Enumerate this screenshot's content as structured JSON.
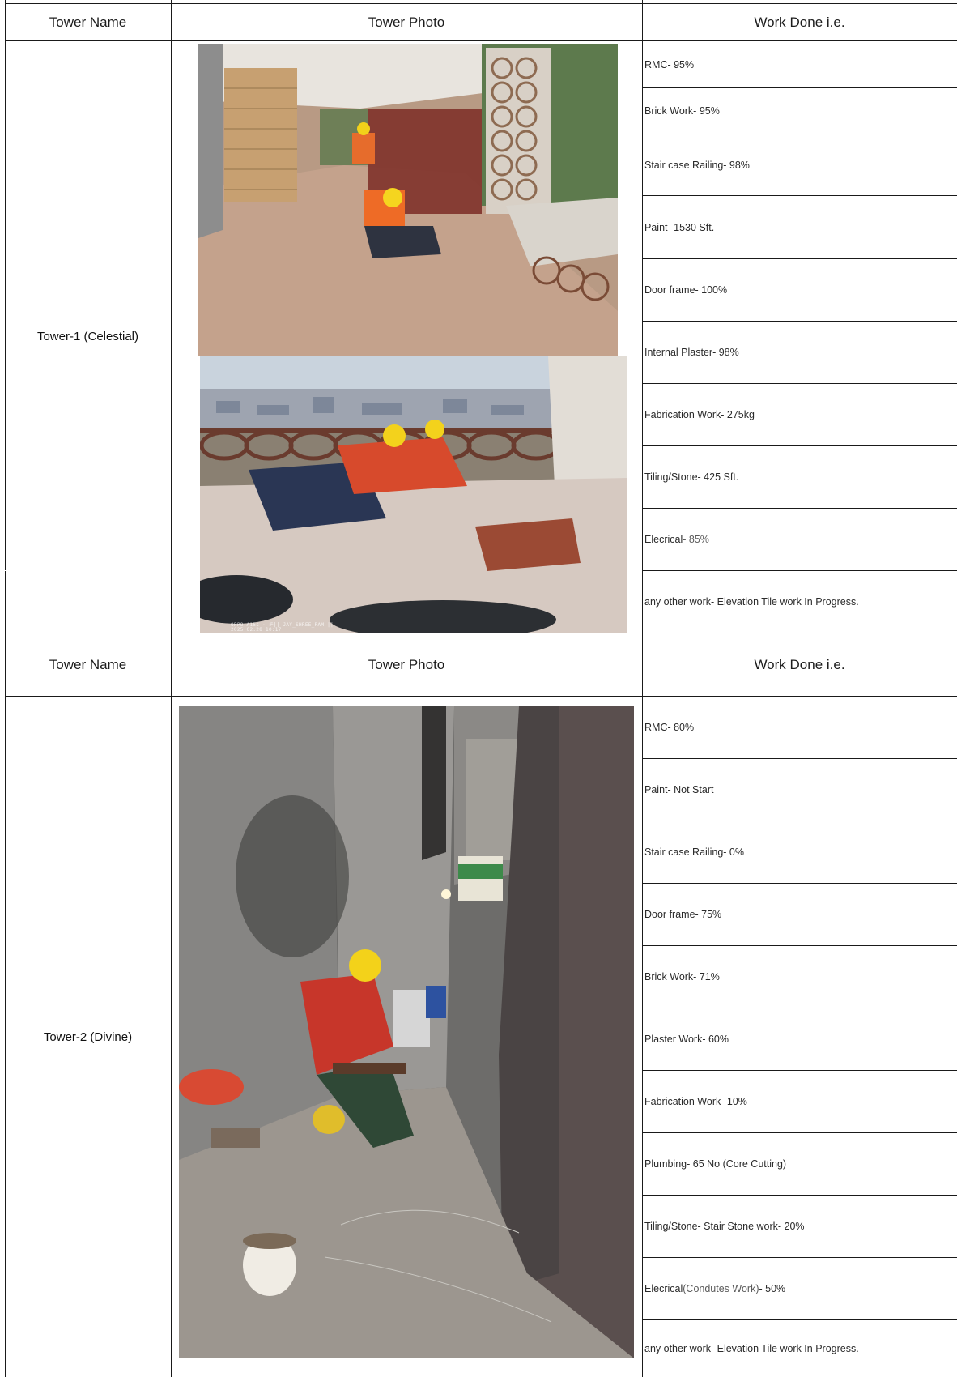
{
  "headers": {
    "tower_name": "Tower Name",
    "tower_photo": "Tower Photo",
    "work_done": "Work Done i.e."
  },
  "towers": [
    {
      "name": "Tower-1 (Celestial)",
      "photos": [
        {
          "name": "tower1-balcony-photo"
        },
        {
          "name": "tower1-railing-photo",
          "stamp_line1": "OPPO A15s · ॐ|| JAY_SHREE_RAM ||",
          "stamp_line2": "2025.02.28 10:17"
        }
      ],
      "work_items": [
        {
          "pre": "RMC- 95%",
          "mid": "",
          "post": ""
        },
        {
          "pre": "Brick Work- 95%",
          "mid": "",
          "post": ""
        },
        {
          "pre": "Stair case Railing- 98%",
          "mid": "",
          "post": ""
        },
        {
          "pre": "Paint- 1530 Sft.",
          "mid": "",
          "post": ""
        },
        {
          "pre": "Door frame- 100%",
          "mid": "",
          "post": ""
        },
        {
          "pre": "Internal Plaster- 98%",
          "mid": "",
          "post": ""
        },
        {
          "pre": "Fabrication Work- 275kg",
          "mid": "",
          "post": ""
        },
        {
          "pre": "Tiling/Stone- 425 Sft.",
          "mid": "",
          "post": ""
        },
        {
          "pre": "Elecrical",
          "mid": "- 85%",
          "post": ""
        },
        {
          "pre": "any other work",
          "mid": "",
          "post": "- Elevation Tile work In Progress."
        }
      ]
    },
    {
      "name": "Tower-2 (Divine)",
      "photos": [
        {
          "name": "tower2-core-cutting-photo"
        }
      ],
      "work_items": [
        {
          "pre": "RMC- 80%",
          "mid": "",
          "post": ""
        },
        {
          "pre": "Paint- Not Start",
          "mid": "",
          "post": ""
        },
        {
          "pre": "Stair case Railing- 0%",
          "mid": "",
          "post": ""
        },
        {
          "pre": "Door frame- 75%",
          "mid": "",
          "post": ""
        },
        {
          "pre": "Brick Work- 71%",
          "mid": "",
          "post": ""
        },
        {
          "pre": "Plaster Work-  60%",
          "mid": "",
          "post": ""
        },
        {
          "pre": "Fabrication Work- 10%",
          "mid": "",
          "post": ""
        },
        {
          "pre": "Plumbing- 65 No (Core Cutting)",
          "mid": "",
          "post": ""
        },
        {
          "pre": "Tiling/Stone- Stair Stone work- 20%",
          "mid": "",
          "post": ""
        },
        {
          "pre": "Elecrical",
          "mid": " (Condutes Work)",
          "post": "- 50%"
        },
        {
          "pre": "any other work",
          "mid": "",
          "post": "- Elevation Tile work In Progress."
        }
      ]
    }
  ],
  "colors": {
    "border": "#1a1a1a",
    "text": "#222222",
    "muted_text": "#5b5b5b"
  }
}
